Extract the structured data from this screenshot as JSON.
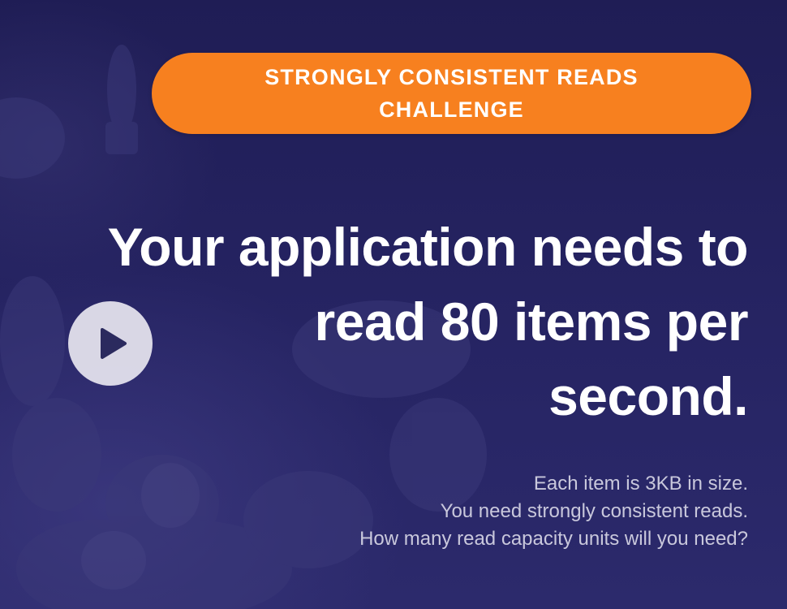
{
  "banner": {
    "line1": "STRONGLY CONSISTENT READS",
    "line2": "CHALLENGE",
    "color": "#f7801f"
  },
  "headline": {
    "line1": "Your application needs to",
    "line2": "read 80 items per",
    "line3": "second."
  },
  "details": {
    "line1": "Each item is 3KB in size.",
    "line2": "You need strongly consistent reads.",
    "line3": "How many read capacity units will you need?"
  },
  "play_button": {
    "icon": "play-icon"
  },
  "colors": {
    "background": "#22205a",
    "accent": "#f7801f",
    "text": "#ffffff",
    "muted_text": "#c9c8dc"
  }
}
